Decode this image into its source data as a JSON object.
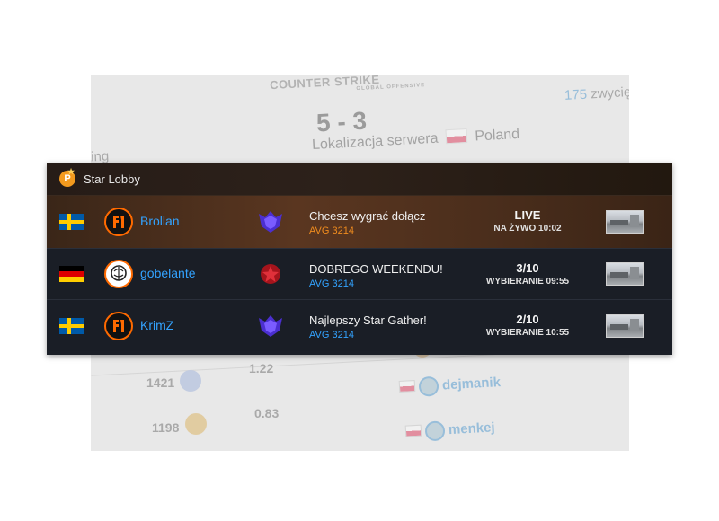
{
  "background": {
    "logo_text": "COUNTER STRIKE",
    "logo_subtext": "GLOBAL OFFENSIVE",
    "wins_number": "175",
    "wins_label": "zwycię",
    "score": "5 - 3",
    "server_location_label": "Lokalizacja serwera",
    "server_location_value": "Poland",
    "partial_text": "ting",
    "stats": [
      {
        "rating": "1421",
        "kdr": "1.22"
      },
      {
        "rating": "1198",
        "kdr": "0.83"
      }
    ],
    "users": [
      "dejmanik",
      "menkej"
    ]
  },
  "lobby": {
    "title": "Star Lobby",
    "rows": [
      {
        "flag": "sweden-flag",
        "team_logo": "fnatic-logo-icon",
        "player": "Brollan",
        "rank_icon": "purple-rank-icon",
        "message": "Chcesz wygrać dołącz",
        "avg": "AVG 3214",
        "status": "LIVE",
        "status_sub": "NA ŻYWO 10:02",
        "map": "map-thumbnail"
      },
      {
        "flag": "germany-flag",
        "team_logo": "brain-logo-icon",
        "player": "gobelante",
        "rank_icon": "red-rank-icon",
        "message": "DOBREGO WEEKENDU!",
        "avg": "AVG 3214",
        "status": "3/10",
        "status_sub": "WYBIERANIE 09:55",
        "map": "map-thumbnail"
      },
      {
        "flag": "sweden-flag",
        "team_logo": "fnatic-logo-icon",
        "player": "KrimZ",
        "rank_icon": "purple-rank-icon",
        "message": "Najlepszy Star Gather!",
        "avg": "AVG 3214",
        "status": "2/10",
        "status_sub": "WYBIERANIE 10:55",
        "map": "map-thumbnail"
      }
    ]
  },
  "colors": {
    "accent_blue": "#33a3ff",
    "accent_orange": "#f08c1e",
    "panel_bg": "#1a1e26"
  }
}
